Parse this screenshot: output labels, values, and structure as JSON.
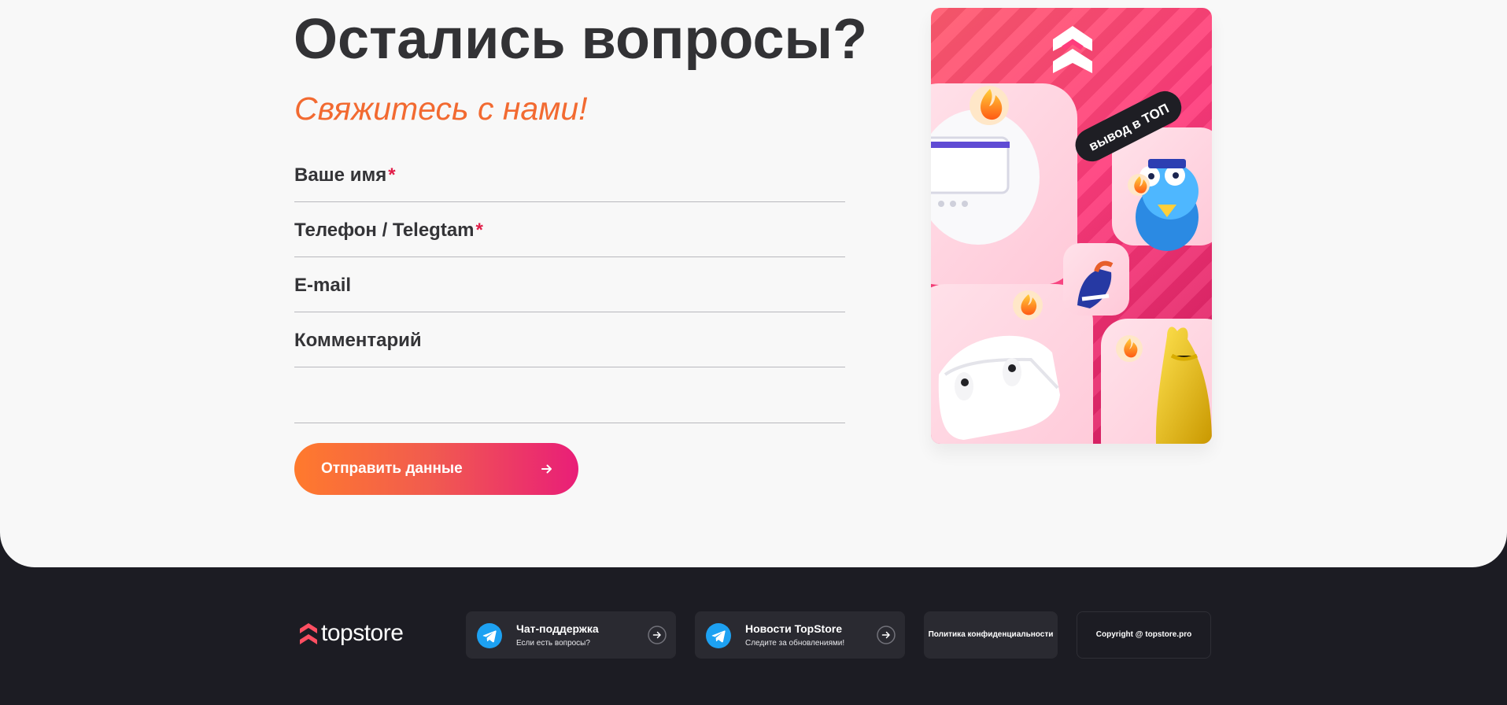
{
  "page": {
    "title": "Остались вопросы?",
    "subtitle": "Свяжитесь с нами!"
  },
  "form": {
    "fields": [
      {
        "label": "Ваше имя",
        "required_mark": "*",
        "value": "",
        "placeholder": ""
      },
      {
        "label": "Телефон / Telegtam",
        "required_mark": "*",
        "value": "",
        "placeholder": ""
      },
      {
        "label": "E-mail",
        "required_mark": "",
        "value": "",
        "placeholder": ""
      },
      {
        "label": "Комментарий",
        "required_mark": "",
        "value": "",
        "placeholder": ""
      }
    ],
    "submit_label": "Отправить данные",
    "submit_icon": "arrow-right-icon"
  },
  "promo": {
    "sticker_text": "вывод в ТОП",
    "logo_icon": "topstore-chevron-logo-icon",
    "product_icons": [
      "fire-icon",
      "headphones-device-icon",
      "toy-bear-icon",
      "iron-icon",
      "airpods-icon",
      "dress-icon"
    ]
  },
  "footer": {
    "logo_text": "topstore",
    "logo_icon": "topstore-chevron-logo-icon",
    "support": {
      "title": "Чат-поддержка",
      "subtitle": "Если есть вопросы?",
      "icon": "telegram-icon"
    },
    "news": {
      "title": "Новости TopStore",
      "subtitle": "Следите за обновлениями!",
      "icon": "telegram-icon"
    },
    "policy": "Политика конфиденциальности",
    "copyright": "Copyright @ topstore.pro"
  },
  "colors": {
    "accent_orange": "#f26a31",
    "accent_pink": "#e91e78",
    "required": "#e11d48",
    "background": "#f8f8f8",
    "footer": "#1c1c23",
    "telegram": "#1da1f2"
  }
}
